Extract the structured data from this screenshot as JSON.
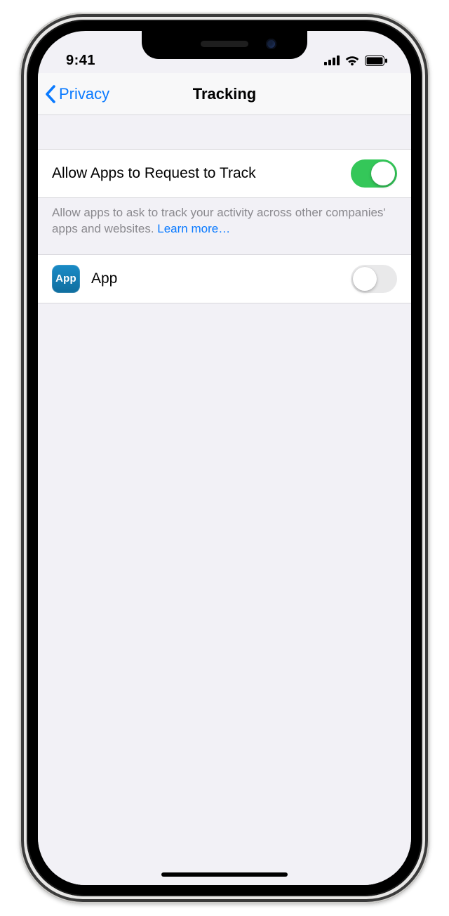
{
  "status": {
    "time": "9:41"
  },
  "nav": {
    "back_label": "Privacy",
    "title": "Tracking"
  },
  "section": {
    "allow_label": "Allow Apps to Request to Track",
    "allow_on": true,
    "footer_text": "Allow apps to ask to track your activity across other companies' apps and websites. ",
    "footer_link": "Learn more…"
  },
  "apps": [
    {
      "icon_text": "App",
      "name": "App",
      "on": false
    }
  ],
  "colors": {
    "link": "#0a7aff",
    "toggle_on": "#34c759"
  }
}
